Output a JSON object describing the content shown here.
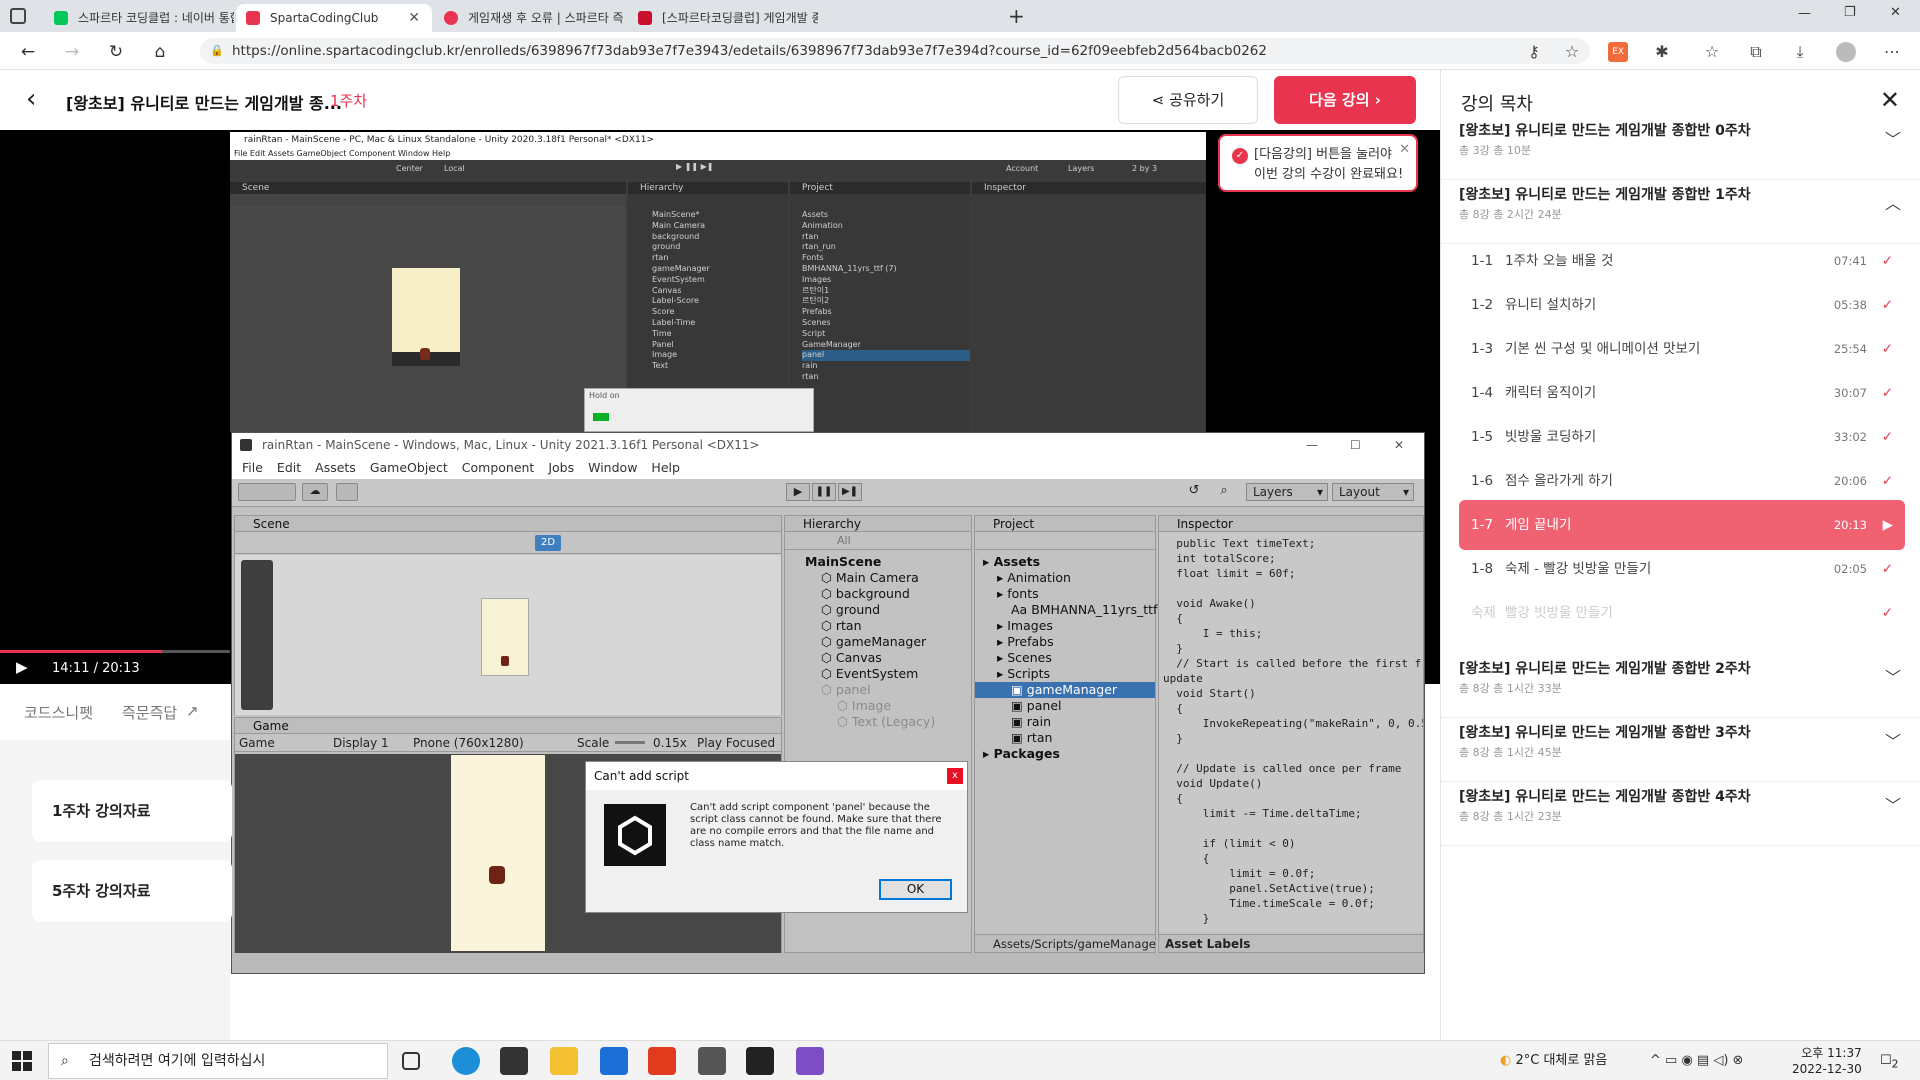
{
  "browser": {
    "tabs": [
      {
        "label": "스파르타 코딩클럽 : 네이버 통합",
        "color": "#03c75a"
      },
      {
        "label": "SpartaCodingClub",
        "color": "#e8344e"
      },
      {
        "label": "게임재생 후 오류 | 스파르타 즉문",
        "color": "#e8344e"
      },
      {
        "label": "[스파르타코딩클럽] 게임개발 종",
        "color": "#e8344e"
      }
    ],
    "new_tab": "+",
    "url": "https://online.spartacodingclub.kr/enrolleds/6398967f73dab93e7f7e3943/edetails/6398967f73dab93e7f7e394d?course_id=62f09eebfeb2d564bacb0262",
    "win_controls": [
      "—",
      "❐",
      "✕"
    ]
  },
  "header": {
    "title": "[왕초보] 유니티로 만드는 게임개발 종...",
    "week": "1주차",
    "share_label": "공유하기",
    "next_label": "다음 강의"
  },
  "tooltip": {
    "text1": "[다음강의] 버튼을 눌러야",
    "text2": "이번 강의 수강이 완료돼요!"
  },
  "video": {
    "current": "14:11",
    "total": "20:13",
    "progress": 0.705
  },
  "unity_top": {
    "title": "rainRtan - MainScene - PC, Mac & Linux Standalone - Unity 2020.3.18f1 Personal* <DX11>",
    "menu": "File  Edit  Assets  GameObject  Component  Window  Help",
    "panels": [
      "Scene",
      "Hierarchy",
      "Project",
      "Inspector"
    ],
    "hierarchy": [
      "MainScene*",
      "Main Camera",
      "background",
      "ground",
      "rtan",
      "gameManager",
      "EventSystem",
      "Canvas",
      "Label-Score",
      "Score",
      "Label-Time",
      "Time",
      "Panel",
      "Image",
      "Text"
    ],
    "project": [
      "Assets",
      "Animation",
      "rtan",
      "rtan_run",
      "Fonts",
      "BMHANNA_11yrs_ttf (7)",
      "Images",
      "르탄이1",
      "르탄이2",
      "Prefabs",
      "Scenes",
      "Script",
      "GameManager",
      "panel",
      "rain",
      "rtan"
    ],
    "hold": "Hold on",
    "toolbar": [
      "Center",
      "Local",
      "Account",
      "Layers",
      "2 by 3"
    ]
  },
  "unity_main": {
    "title": "rainRtan - MainScene - Windows, Mac, Linux - Unity 2021.3.16f1 Personal <DX11>",
    "menu": [
      "File",
      "Edit",
      "Assets",
      "GameObject",
      "Component",
      "Jobs",
      "Window",
      "Help"
    ],
    "layers": "Layers",
    "layout": "Layout",
    "scene_tab": "Scene",
    "btn2d": "2D",
    "hierarchy_tab": "Hierarchy",
    "hierarchy_search": "All",
    "hierarchy": [
      {
        "label": "MainScene",
        "indent": 0,
        "bold": true
      },
      {
        "label": "Main Camera",
        "indent": 1
      },
      {
        "label": "background",
        "indent": 1
      },
      {
        "label": "ground",
        "indent": 1
      },
      {
        "label": "rtan",
        "indent": 1
      },
      {
        "label": "gameManager",
        "indent": 1
      },
      {
        "label": "Canvas",
        "indent": 1
      },
      {
        "label": "EventSystem",
        "indent": 1
      },
      {
        "label": "panel",
        "indent": 1,
        "dim": true
      },
      {
        "label": "Image",
        "indent": 2,
        "dim": true
      },
      {
        "label": "Text (Legacy)",
        "indent": 2,
        "dim": true
      }
    ],
    "project_tab": "Project",
    "project": [
      {
        "label": "Assets",
        "indent": 0,
        "bold": true
      },
      {
        "label": "Animation",
        "indent": 1
      },
      {
        "label": "fonts",
        "indent": 1
      },
      {
        "label": "BMHANNA_11yrs_ttf",
        "indent": 2
      },
      {
        "label": "Images",
        "indent": 1
      },
      {
        "label": "Prefabs",
        "indent": 1
      },
      {
        "label": "Scenes",
        "indent": 1
      },
      {
        "label": "Scripts",
        "indent": 1
      },
      {
        "label": "gameManager",
        "indent": 2,
        "selected": true
      },
      {
        "label": "panel",
        "indent": 2
      },
      {
        "label": "rain",
        "indent": 2
      },
      {
        "label": "rtan",
        "indent": 2
      },
      {
        "label": "Packages",
        "indent": 0,
        "bold": true
      }
    ],
    "project_path": "Assets/Scripts/gameManage",
    "inspector_tab": "Inspector",
    "asset_labels": "Asset Labels",
    "code": "  public Text timeText;\n  int totalScore;\n  float limit = 60f;\n\n  void Awake()\n  {\n      I = this;\n  }\n  // Start is called before the first frame\nupdate\n  void Start()\n  {\n      InvokeRepeating(\"makeRain\", 0, 0.5f);\n  }\n\n  // Update is called once per frame\n  void Update()\n  {\n      limit -= Time.deltaTime;\n\n      if (limit < 0)\n      {\n          limit = 0.0f;\n          panel.SetActive(true);\n          Time.timeScale = 0.0f;\n      }",
    "game_tab": "Game",
    "game_dropdown": "Game",
    "display": "Display 1",
    "resolution": "Pnone (760x1280)",
    "scale_label": "Scale",
    "scale_value": "0.15x",
    "play_focused": "Play Focused"
  },
  "dialog": {
    "title": "Can't add script",
    "message": "Can't add script component 'panel' because the script class cannot be found. Make sure that there are no compile errors and that the file name and class name match.",
    "ok": "OK"
  },
  "below": {
    "tab1": "코드스니펫",
    "tab2": "즉문즉답",
    "mat1": "1주차 강의자료",
    "mat2": "5주차 강의자료"
  },
  "sidebar": {
    "title": "강의 목차",
    "weeks": [
      {
        "title": "[왕초보] 유니티로 만드는 게임개발 종합반 0주차",
        "meta": "총 3강    총 10분"
      },
      {
        "title": "[왕초보] 유니티로 만드는 게임개발 종합반 1주차",
        "meta": "총 8강    총 2시간 24분"
      },
      {
        "title": "[왕초보] 유니티로 만드는 게임개발 종합반 2주차",
        "meta": "총 8강    총 1시간 33분"
      },
      {
        "title": "[왕초보] 유니티로 만드는 게임개발 종합반 3주차",
        "meta": "총 8강    총 1시간 45분"
      },
      {
        "title": "[왕초보] 유니티로 만드는 게임개발 종합반 4주차",
        "meta": "총 8강    총 1시간 23분"
      }
    ],
    "lessons": [
      {
        "num": "1-1",
        "title": "1주차 오늘 배울 것",
        "dur": "07:41",
        "mark": "✓"
      },
      {
        "num": "1-2",
        "title": "유니티 설치하기",
        "dur": "05:38",
        "mark": "✓"
      },
      {
        "num": "1-3",
        "title": "기본 씬 구성 및 애니메이션 맛보기",
        "dur": "25:54",
        "mark": "✓"
      },
      {
        "num": "1-4",
        "title": "캐릭터 움직이기",
        "dur": "30:07",
        "mark": "✓"
      },
      {
        "num": "1-5",
        "title": "빗방울 코딩하기",
        "dur": "33:02",
        "mark": "✓"
      },
      {
        "num": "1-6",
        "title": "점수 올라가게 하기",
        "dur": "20:06",
        "mark": "✓"
      },
      {
        "num": "1-7",
        "title": "게임 끝내기",
        "dur": "20:13",
        "mark": "▶"
      },
      {
        "num": "1-8",
        "title": "숙제 - 빨강 빗방울 만들기",
        "dur": "02:05",
        "mark": "✓"
      },
      {
        "num": "숙제",
        "title": "빨강 빗방울 만들기",
        "dur": "",
        "mark": "✓"
      }
    ],
    "active_lesson": "1-7"
  },
  "taskbar": {
    "search_placeholder": "검색하려면 여기에 입력하십시",
    "weather": "2°C  대체로 맑음",
    "time": "오후 11:37",
    "date": "2022-12-30",
    "notif": "2"
  },
  "colors": {
    "accent": "#e8344e",
    "active_lesson": "#f06272"
  }
}
